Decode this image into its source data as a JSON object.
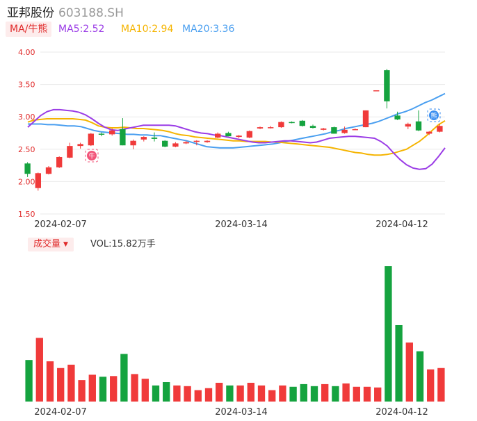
{
  "header": {
    "name": "亚邦股份",
    "code": "603188.SH"
  },
  "ma_legend": {
    "tag": "MA/牛熊",
    "items": [
      {
        "label": "MA5:2.52",
        "color": "#9b3de6"
      },
      {
        "label": "MA10:2.94",
        "color": "#f5b400"
      },
      {
        "label": "MA20:3.36",
        "color": "#4a9ff0"
      }
    ]
  },
  "volume_legend": {
    "tag": "成交量",
    "caret": "▼",
    "text": "VOL:15.82万手"
  },
  "colors": {
    "up": "#f03a3a",
    "down": "#15a33f",
    "ma5": "#9b3de6",
    "ma10": "#f5b400",
    "ma20": "#4a9ff0",
    "grid": "#e9e9e9",
    "axis_text": "#e02a2a",
    "date_text": "#333333"
  },
  "markers": [
    {
      "index": 6,
      "icon": "bull-icon",
      "glyph": "牛"
    },
    {
      "index": 38,
      "icon": "bear-icon",
      "glyph": "熊"
    }
  ],
  "chart_data": {
    "type": "candlestick",
    "y_axis": {
      "ticks": [
        "4.00",
        "3.50",
        "3.00",
        "2.50",
        "2.00",
        "1.50"
      ],
      "ylim": [
        1.5,
        4.0
      ]
    },
    "x_axis": {
      "tick_labels": [
        {
          "index": 3,
          "label": "2024-02-07"
        },
        {
          "index": 20,
          "label": "2024-03-14"
        },
        {
          "index": 35,
          "label": "2024-04-12"
        }
      ]
    },
    "candles": [
      {
        "o": 2.28,
        "h": 2.3,
        "l": 2.07,
        "c": 2.12
      },
      {
        "o": 1.9,
        "h": 2.14,
        "l": 1.86,
        "c": 2.13
      },
      {
        "o": 2.12,
        "h": 2.24,
        "l": 2.11,
        "c": 2.22
      },
      {
        "o": 2.22,
        "h": 2.39,
        "l": 2.21,
        "c": 2.38
      },
      {
        "o": 2.37,
        "h": 2.6,
        "l": 2.36,
        "c": 2.55
      },
      {
        "o": 2.55,
        "h": 2.6,
        "l": 2.51,
        "c": 2.58
      },
      {
        "o": 2.56,
        "h": 2.75,
        "l": 2.55,
        "c": 2.74
      },
      {
        "o": 2.74,
        "h": 2.76,
        "l": 2.7,
        "c": 2.73
      },
      {
        "o": 2.73,
        "h": 2.82,
        "l": 2.71,
        "c": 2.79
      },
      {
        "o": 2.81,
        "h": 2.98,
        "l": 2.56,
        "c": 2.56
      },
      {
        "o": 2.56,
        "h": 2.65,
        "l": 2.5,
        "c": 2.63
      },
      {
        "o": 2.65,
        "h": 2.7,
        "l": 2.62,
        "c": 2.69
      },
      {
        "o": 2.68,
        "h": 2.76,
        "l": 2.62,
        "c": 2.66
      },
      {
        "o": 2.63,
        "h": 2.64,
        "l": 2.53,
        "c": 2.54
      },
      {
        "o": 2.54,
        "h": 2.61,
        "l": 2.53,
        "c": 2.59
      },
      {
        "o": 2.59,
        "h": 2.63,
        "l": 2.58,
        "c": 2.61
      },
      {
        "o": 2.62,
        "h": 2.64,
        "l": 2.56,
        "c": 2.63
      },
      {
        "o": 2.61,
        "h": 2.64,
        "l": 2.6,
        "c": 2.63
      },
      {
        "o": 2.68,
        "h": 2.76,
        "l": 2.67,
        "c": 2.74
      },
      {
        "o": 2.75,
        "h": 2.77,
        "l": 2.7,
        "c": 2.7
      },
      {
        "o": 2.69,
        "h": 2.72,
        "l": 2.67,
        "c": 2.71
      },
      {
        "o": 2.68,
        "h": 2.79,
        "l": 2.67,
        "c": 2.78
      },
      {
        "o": 2.82,
        "h": 2.85,
        "l": 2.81,
        "c": 2.84
      },
      {
        "o": 2.83,
        "h": 2.86,
        "l": 2.82,
        "c": 2.84
      },
      {
        "o": 2.84,
        "h": 2.93,
        "l": 2.83,
        "c": 2.92
      },
      {
        "o": 2.92,
        "h": 2.93,
        "l": 2.9,
        "c": 2.91
      },
      {
        "o": 2.94,
        "h": 2.95,
        "l": 2.85,
        "c": 2.86
      },
      {
        "o": 2.86,
        "h": 2.88,
        "l": 2.82,
        "c": 2.83
      },
      {
        "o": 2.8,
        "h": 2.83,
        "l": 2.79,
        "c": 2.82
      },
      {
        "o": 2.84,
        "h": 2.85,
        "l": 2.74,
        "c": 2.74
      },
      {
        "o": 2.75,
        "h": 2.85,
        "l": 2.74,
        "c": 2.8
      },
      {
        "o": 2.81,
        "h": 2.82,
        "l": 2.8,
        "c": 2.81
      },
      {
        "o": 2.84,
        "h": 3.1,
        "l": 2.84,
        "c": 3.1
      },
      {
        "o": 3.4,
        "h": 3.41,
        "l": 3.4,
        "c": 3.41
      },
      {
        "o": 3.72,
        "h": 3.74,
        "l": 3.13,
        "c": 3.24
      },
      {
        "o": 3.02,
        "h": 3.08,
        "l": 2.95,
        "c": 2.96
      },
      {
        "o": 2.85,
        "h": 2.91,
        "l": 2.81,
        "c": 2.89
      },
      {
        "o": 2.93,
        "h": 3.1,
        "l": 2.78,
        "c": 2.79
      },
      {
        "o": 2.74,
        "h": 2.78,
        "l": 2.72,
        "c": 2.77
      },
      {
        "o": 2.77,
        "h": 2.89,
        "l": 2.76,
        "c": 2.86
      }
    ],
    "ma5": [
      2.84,
      2.93,
      3.02,
      3.08,
      3.11,
      3.11,
      3.1,
      3.09,
      3.07,
      3.03,
      2.97,
      2.9,
      2.84,
      2.8,
      2.79,
      2.81,
      2.83,
      2.85,
      2.87,
      2.87,
      2.87,
      2.87,
      2.87,
      2.86,
      2.83,
      2.8,
      2.77,
      2.75,
      2.74,
      2.72,
      2.71,
      2.69,
      2.67,
      2.65,
      2.63,
      2.61,
      2.6,
      2.6,
      2.61,
      2.62,
      2.63,
      2.63,
      2.62,
      2.61,
      2.6,
      2.61,
      2.64,
      2.67,
      2.68,
      2.69,
      2.7,
      2.7,
      2.69,
      2.68,
      2.67,
      2.62,
      2.55,
      2.44,
      2.34,
      2.26,
      2.21,
      2.19,
      2.2,
      2.27,
      2.39,
      2.52
    ],
    "ma10": [
      2.92,
      2.95,
      2.96,
      2.97,
      2.97,
      2.97,
      2.97,
      2.97,
      2.96,
      2.95,
      2.91,
      2.86,
      2.84,
      2.83,
      2.83,
      2.84,
      2.83,
      2.82,
      2.82,
      2.81,
      2.8,
      2.79,
      2.77,
      2.74,
      2.72,
      2.71,
      2.69,
      2.68,
      2.67,
      2.66,
      2.65,
      2.64,
      2.63,
      2.63,
      2.62,
      2.62,
      2.62,
      2.62,
      2.61,
      2.61,
      2.6,
      2.59,
      2.58,
      2.57,
      2.56,
      2.55,
      2.54,
      2.53,
      2.51,
      2.49,
      2.47,
      2.45,
      2.44,
      2.42,
      2.41,
      2.41,
      2.42,
      2.44,
      2.47,
      2.5,
      2.56,
      2.62,
      2.7,
      2.79,
      2.88,
      2.94
    ],
    "ma20": [
      2.89,
      2.89,
      2.89,
      2.88,
      2.88,
      2.87,
      2.86,
      2.86,
      2.85,
      2.82,
      2.79,
      2.77,
      2.76,
      2.75,
      2.74,
      2.73,
      2.73,
      2.72,
      2.72,
      2.71,
      2.71,
      2.69,
      2.67,
      2.65,
      2.63,
      2.6,
      2.57,
      2.54,
      2.53,
      2.52,
      2.52,
      2.52,
      2.53,
      2.54,
      2.55,
      2.56,
      2.57,
      2.58,
      2.6,
      2.62,
      2.64,
      2.66,
      2.68,
      2.7,
      2.72,
      2.74,
      2.77,
      2.79,
      2.82,
      2.84,
      2.86,
      2.88,
      2.9,
      2.93,
      2.97,
      3.01,
      3.05,
      3.08,
      3.12,
      3.17,
      3.22,
      3.26,
      3.31,
      3.36
    ],
    "volume": {
      "ylim": [
        0,
        20.0
      ],
      "values": [
        6.2,
        9.5,
        6.0,
        5.0,
        5.5,
        3.2,
        4.0,
        3.7,
        3.8,
        7.1,
        4.1,
        3.4,
        2.4,
        2.9,
        2.4,
        2.3,
        1.7,
        2.0,
        2.8,
        2.4,
        2.4,
        2.8,
        2.4,
        1.7,
        2.4,
        2.2,
        2.6,
        2.3,
        2.6,
        2.3,
        2.7,
        2.2,
        2.2,
        2.1,
        20.2,
        11.4,
        8.8,
        7.5,
        4.8,
        5.0
      ],
      "unit": "万手"
    }
  }
}
